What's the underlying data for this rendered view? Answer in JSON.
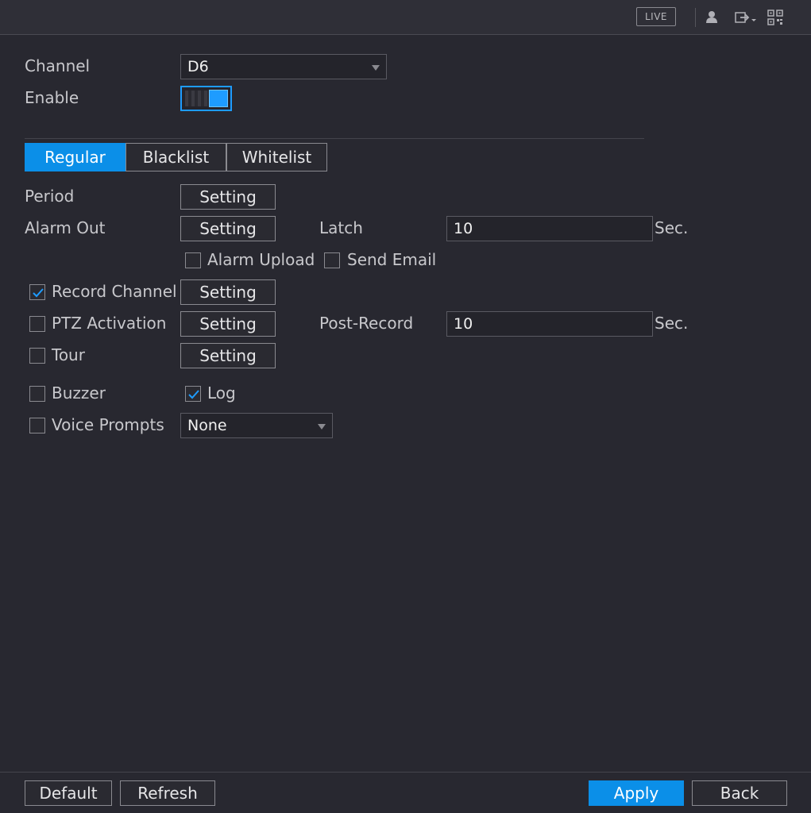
{
  "topbar": {
    "live_label": "LIVE",
    "icons": [
      "user-icon",
      "logout-icon",
      "qr-code-icon"
    ]
  },
  "form": {
    "channel_label": "Channel",
    "channel_value": "D6",
    "enable_label": "Enable",
    "enable_on": true
  },
  "tabs": [
    {
      "label": "Regular",
      "active": true
    },
    {
      "label": "Blacklist",
      "active": false
    },
    {
      "label": "Whitelist",
      "active": false
    }
  ],
  "rows": {
    "period_label": "Period",
    "alarm_out_label": "Alarm Out",
    "latch_label": "Latch",
    "latch_value": "10",
    "sec_label": "Sec.",
    "alarm_upload_label": "Alarm Upload",
    "alarm_upload_checked": false,
    "send_email_label": "Send Email",
    "send_email_checked": false,
    "record_channel_label": "Record Channel",
    "record_channel_checked": true,
    "ptz_label": "PTZ Activation",
    "ptz_checked": false,
    "post_record_label": "Post-Record",
    "post_record_value": "10",
    "tour_label": "Tour",
    "tour_checked": false,
    "buzzer_label": "Buzzer",
    "buzzer_checked": false,
    "log_label": "Log",
    "log_checked": true,
    "voice_prompts_label": "Voice Prompts",
    "voice_prompts_checked": false,
    "voice_prompts_value": "None",
    "setting_label": "Setting"
  },
  "footer": {
    "default_label": "Default",
    "refresh_label": "Refresh",
    "apply_label": "Apply",
    "back_label": "Back"
  },
  "colors": {
    "accent": "#0b8fe8",
    "background": "#282830"
  }
}
